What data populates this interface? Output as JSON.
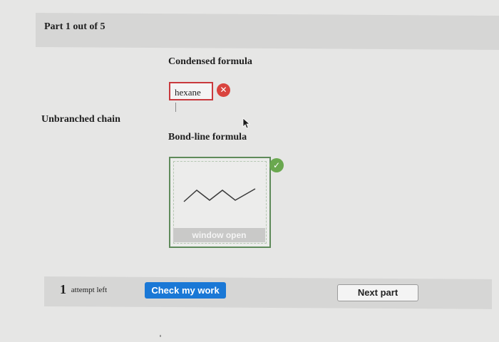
{
  "header": {
    "part_label": "Part 1 out of 5"
  },
  "question": {
    "row_label": "Unbranched chain",
    "condensed_label": "Condensed formula",
    "condensed_answer": "hexane",
    "condensed_status": "incorrect",
    "bondline_label": "Bond-line formula",
    "bondline_status": "correct",
    "window_button": "window open"
  },
  "footer": {
    "attempts_count": "1",
    "attempts_text": "attempt left",
    "check_button": "Check my work",
    "next_button": "Next part"
  },
  "colors": {
    "primary_button": "#1a78d6",
    "error": "#d9443e",
    "success": "#6aa84f"
  }
}
